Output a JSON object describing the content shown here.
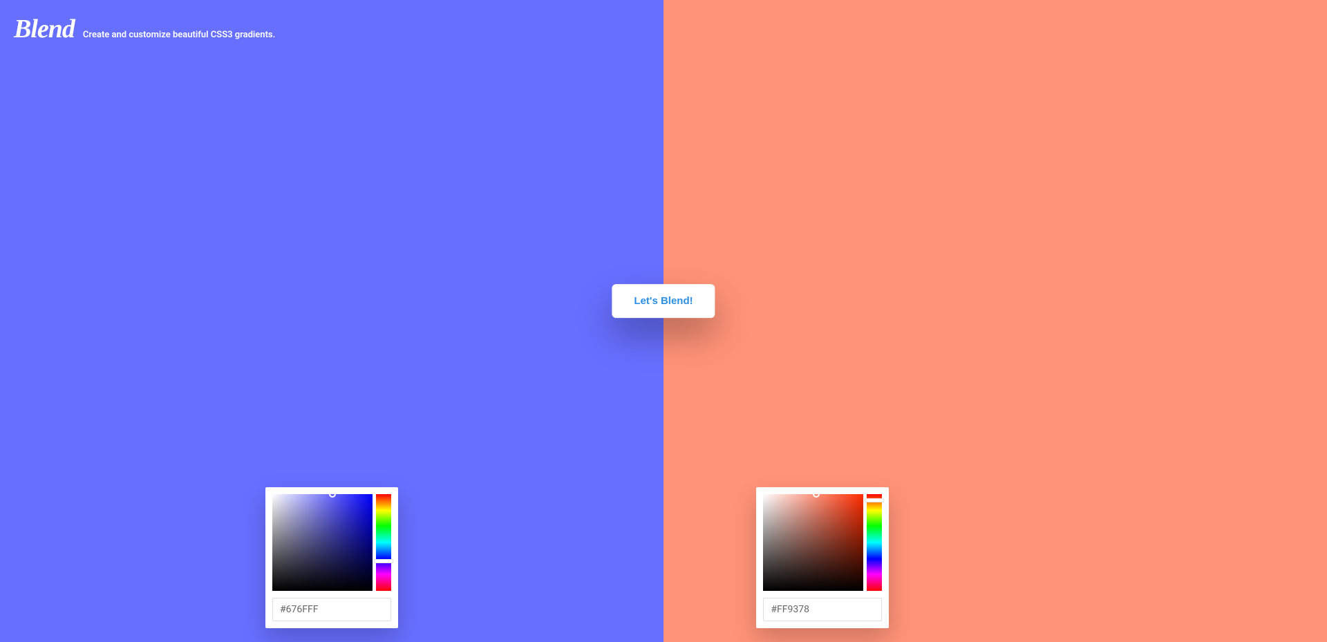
{
  "header": {
    "logo": "Blend",
    "tagline": "Create and customize beautiful CSS3 gradients."
  },
  "main": {
    "blend_button_label": "Let's Blend!",
    "left_color_hex": "#676FFF",
    "right_color_hex": "#FF9378"
  },
  "picker_left": {
    "hex_value": "#676FFF",
    "sat_indicator_x": "60%",
    "sat_indicator_y": "0%",
    "hue_indicator_y": "67%"
  },
  "picker_right": {
    "hex_value": "#FF9378",
    "sat_indicator_x": "53%",
    "sat_indicator_y": "0%",
    "hue_indicator_y": "4%"
  }
}
